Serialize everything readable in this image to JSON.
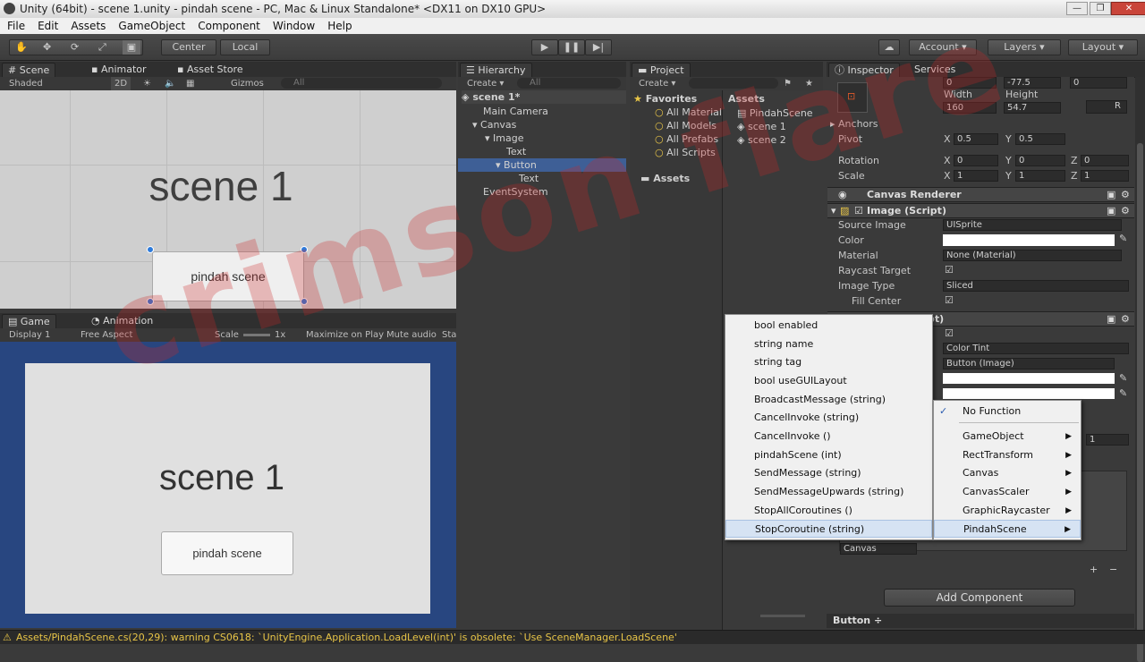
{
  "window": {
    "title": "Unity (64bit) - scene 1.unity - pindah scene - PC, Mac & Linux Standalone* <DX11 on DX10 GPU>",
    "minimize": "—",
    "maximize": "❐",
    "close": "✕"
  },
  "menu": [
    "File",
    "Edit",
    "Assets",
    "GameObject",
    "Component",
    "Window",
    "Help"
  ],
  "toolbar": {
    "pivot_center": "Center",
    "pivot_local": "Local",
    "account": "Account",
    "layers": "Layers",
    "layout": "Layout"
  },
  "scene_panel": {
    "tabs": [
      "Scene",
      "Animator",
      "Asset Store"
    ],
    "shading": "Shaded",
    "mode_2d": "2D",
    "gizmos": "Gizmos",
    "search_placeholder": "All",
    "title_text": "scene 1",
    "button_text": "pindah scene"
  },
  "game_panel": {
    "tabs": [
      "Game",
      "Animation"
    ],
    "display": "Display 1",
    "aspect": "Free Aspect",
    "scale_label": "Scale",
    "scale_value": "1x",
    "maximize": "Maximize on Play",
    "mute": "Mute audio",
    "stats": "Sta",
    "title_text": "scene 1",
    "button_text": "pindah scene"
  },
  "hierarchy": {
    "tab": "Hierarchy",
    "create": "Create",
    "search_placeholder": "All",
    "scene": "scene 1*",
    "items": [
      "Main Camera",
      "Canvas",
      "Image",
      "Text",
      "Button",
      "Text",
      "EventSystem"
    ]
  },
  "project": {
    "tab": "Project",
    "create": "Create",
    "favorites": "Favorites",
    "favorite_items": [
      "All Material",
      "All Models",
      "All Prefabs",
      "All Scripts"
    ],
    "assets_root": "Assets",
    "assets_header": "Assets",
    "asset_items": [
      "PindahScene",
      "scene 1",
      "scene 2"
    ]
  },
  "inspector": {
    "tabs": [
      "Inspector",
      "Services"
    ],
    "pos_x": "0",
    "pos_y": "-77.5",
    "pos_z": "0",
    "width_label": "Width",
    "height_label": "Height",
    "width": "160",
    "height": "54.7",
    "anchors": "Anchors",
    "pivot_label": "Pivot",
    "pivot_x": "0.5",
    "pivot_y": "0.5",
    "rotation_label": "Rotation",
    "rot": [
      "0",
      "0",
      "0"
    ],
    "scale_label": "Scale",
    "scl": [
      "1",
      "1",
      "1"
    ],
    "axis_x": "X",
    "axis_y": "Y",
    "axis_z": "Z",
    "rect_r": "R",
    "canvas_renderer": "Canvas Renderer",
    "image_script": "Image (Script)",
    "source_image_label": "Source Image",
    "source_image": "UISprite",
    "color_label": "Color",
    "material_label": "Material",
    "material": "None (Material)",
    "raycast_label": "Raycast Target",
    "image_type_label": "Image Type",
    "image_type": "Sliced",
    "fill_center_label": "Fill Center",
    "button_script_tail": "pt)",
    "transition": "Color Tint",
    "target_graphic": "Button (Image)",
    "multiplier_value": "1",
    "onclick_target": "Canvas",
    "add_component": "Add Component",
    "preview": "Button ÷"
  },
  "function_menu": {
    "left_items": [
      "bool enabled",
      "string name",
      "string tag",
      "bool useGUILayout",
      "BroadcastMessage (string)",
      "CancelInvoke (string)",
      "CancelInvoke ()",
      "pindahScene (int)",
      "SendMessage (string)",
      "SendMessageUpwards (string)",
      "StopAllCoroutines ()",
      "StopCoroutine (string)"
    ],
    "right_items": [
      "No Function",
      "GameObject",
      "RectTransform",
      "Canvas",
      "CanvasScaler",
      "GraphicRaycaster",
      "PindahScene"
    ],
    "check": "✓"
  },
  "status": "Assets/PindahScene.cs(20,29): warning CS0618: `UnityEngine.Application.LoadLevel(int)' is obsolete: `Use SceneManager.LoadScene'",
  "watermark": "crimson flare",
  "colors": {
    "selection": "#3e5f96",
    "game_bg": "#284680",
    "warning": "#e8c547"
  }
}
